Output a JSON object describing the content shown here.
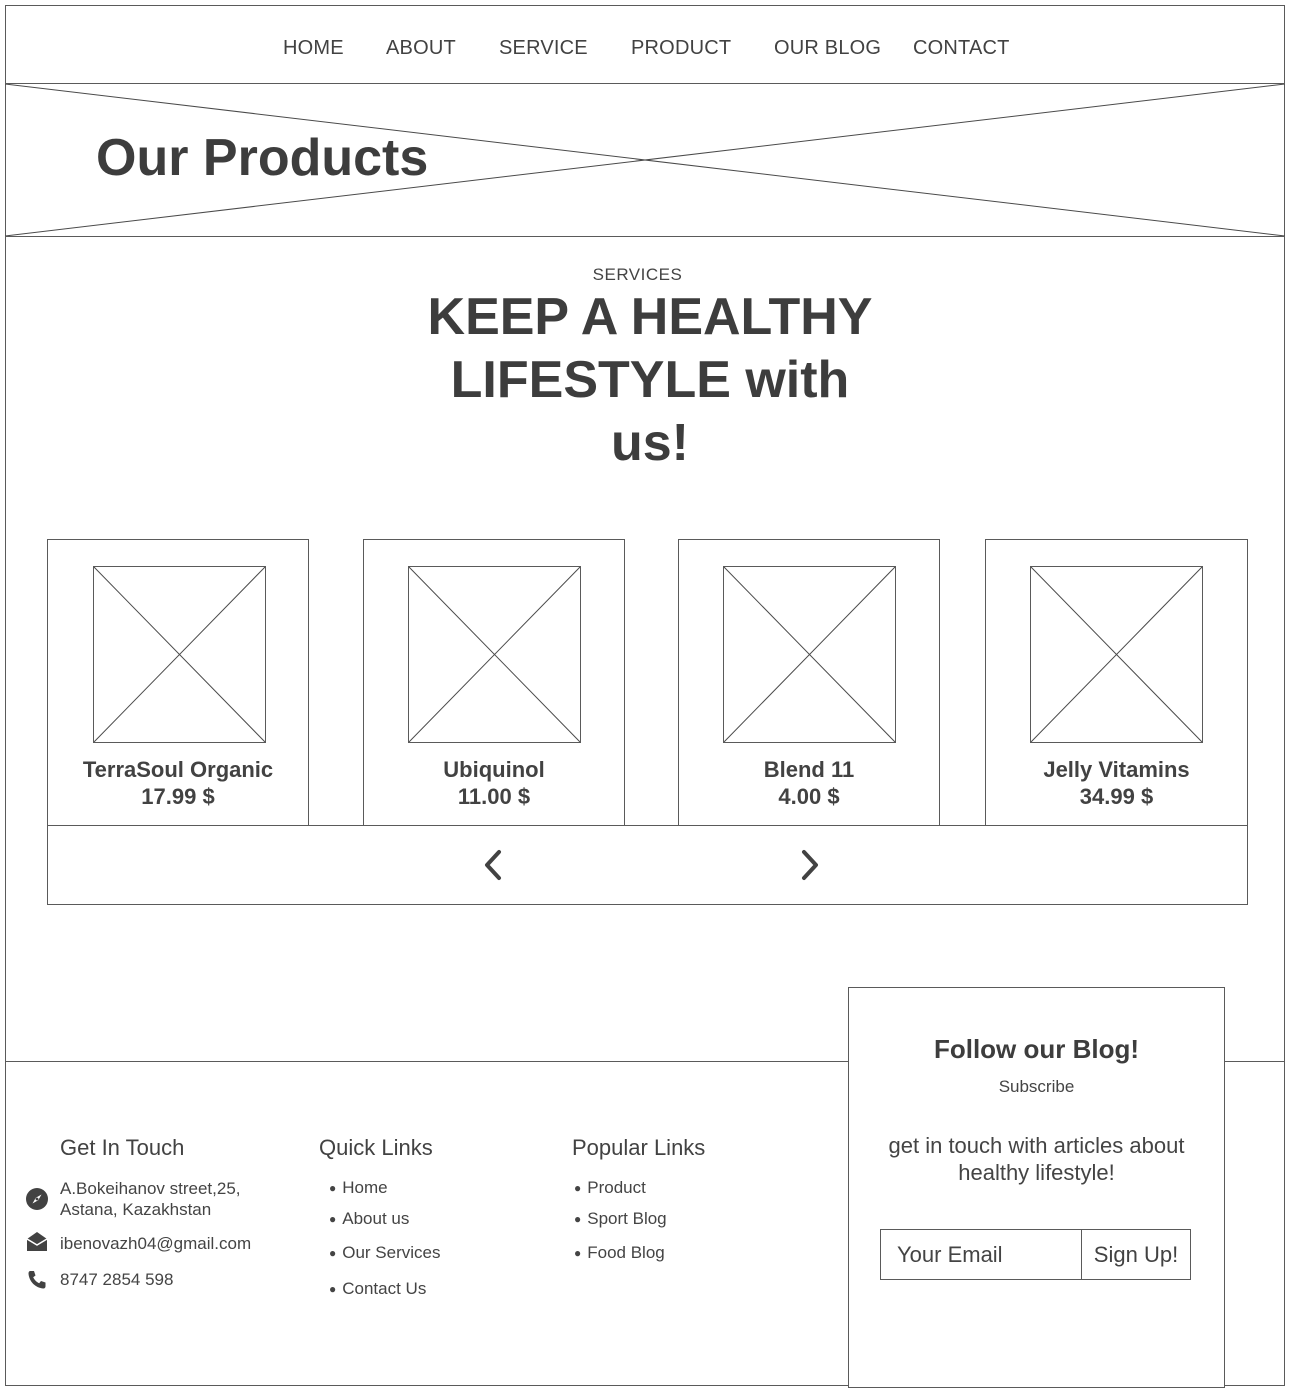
{
  "nav": {
    "items": [
      "HOME",
      "ABOUT",
      "SERVICE",
      "PRODUCT",
      "OUR BLOG",
      "CONTACT"
    ]
  },
  "hero": {
    "title": "Our Products"
  },
  "section": {
    "eyebrow": "SERVICES",
    "headline_lines": [
      "KEEP A HEALTHY",
      "LIFESTYLE with",
      "us!"
    ]
  },
  "products": [
    {
      "name": "TerraSoul Organic",
      "price": "17.99 $"
    },
    {
      "name": "Ubiquinol",
      "price": "11.00 $"
    },
    {
      "name": "Blend 11",
      "price": "4.00 $"
    },
    {
      "name": "Jelly Vitamins",
      "price": "34.99 $"
    }
  ],
  "carousel": {
    "prev_icon": "chevron-left-icon",
    "next_icon": "chevron-right-icon"
  },
  "footer": {
    "get_in_touch": {
      "heading": "Get In Touch",
      "address_line1": "A.Bokeihanov street,25,",
      "address_line2": "Astana, Kazakhstan",
      "email": "ibenovazh04@gmail.com",
      "phone": "8747 2854 598",
      "address_icon": "compass-icon",
      "email_icon": "envelope-open-icon",
      "phone_icon": "phone-icon"
    },
    "quick_links": {
      "heading": "Quick Links",
      "items": [
        "Home",
        "About us",
        "Our Services",
        "Contact Us"
      ]
    },
    "popular_links": {
      "heading": "Popular Links",
      "items": [
        "Product",
        "Sport Blog",
        "Food Blog"
      ]
    }
  },
  "subscribe": {
    "title": "Follow our Blog!",
    "small": "Subscribe",
    "text_line1": "get in touch with articles about",
    "text_line2": "healthy lifestyle!",
    "email_placeholder": "Your Email",
    "button_label": "Sign Up!"
  },
  "colors": {
    "text": "#424242",
    "border": "#5a5a5a",
    "background": "#ffffff"
  }
}
